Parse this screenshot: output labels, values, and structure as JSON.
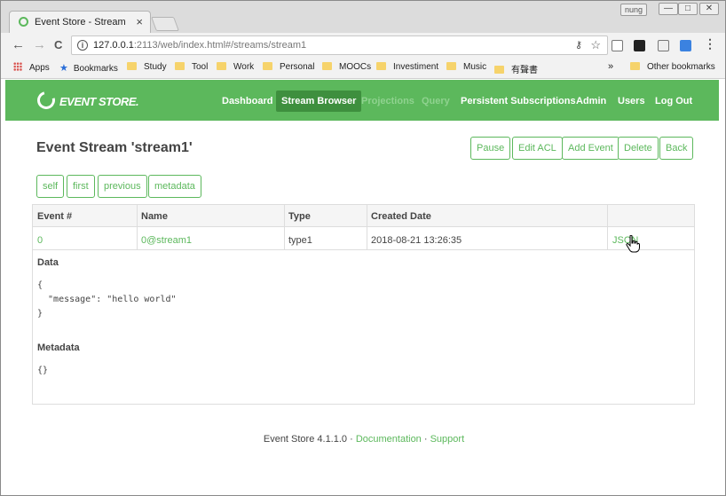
{
  "browser": {
    "tab_title": "Event Store - Stream",
    "tab_close": "×",
    "user_badge": "nung",
    "win_min": "—",
    "win_max": "□",
    "win_close": "✕",
    "back": "←",
    "forward": "→",
    "reload": "C",
    "url_host": "127.0.0.1",
    "url_rest": ":2113/web/index.html#/streams/stream1",
    "info_glyph": "i",
    "key_glyph": "⚷",
    "star_glyph": "☆",
    "menu_glyph": "⋮",
    "bookmarks": {
      "apps": "Apps",
      "bookmarks": "Bookmarks",
      "study": "Study",
      "tool": "Tool",
      "work": "Work",
      "personal": "Personal",
      "moocs": "MOOCs",
      "investiment": "Investiment",
      "music": "Music",
      "folder_cn": "有聲書",
      "overflow": "»",
      "other": "Other bookmarks"
    }
  },
  "app": {
    "logo": "EVENT STORE.",
    "nav": {
      "dashboard": "Dashboard",
      "stream_browser": "Stream Browser",
      "projections": "Projections",
      "query": "Query",
      "persistent": "Persistent Subscriptions",
      "admin": "Admin",
      "users": "Users",
      "logout": "Log Out"
    },
    "page_title": "Event Stream 'stream1'",
    "actions": {
      "pause": "Pause",
      "edit_acl": "Edit ACL",
      "add_event": "Add Event",
      "delete": "Delete",
      "back": "Back"
    },
    "links": {
      "self": "self",
      "first": "first",
      "previous": "previous",
      "metadata": "metadata"
    },
    "table": {
      "headers": {
        "event": "Event #",
        "name": "Name",
        "type": "Type",
        "created": "Created Date"
      },
      "row": {
        "event": "0",
        "name": "0@stream1",
        "type": "type1",
        "created": "2018-08-21 13:26:35",
        "json": "JSON"
      }
    },
    "data_label": "Data",
    "data_code": "{\n  \"message\": \"hello world\"\n}",
    "metadata_label": "Metadata",
    "metadata_code": "{}",
    "footer": {
      "version": "Event Store 4.1.1.0 · ",
      "documentation": "Documentation",
      "sep": " · ",
      "support": "Support"
    }
  }
}
